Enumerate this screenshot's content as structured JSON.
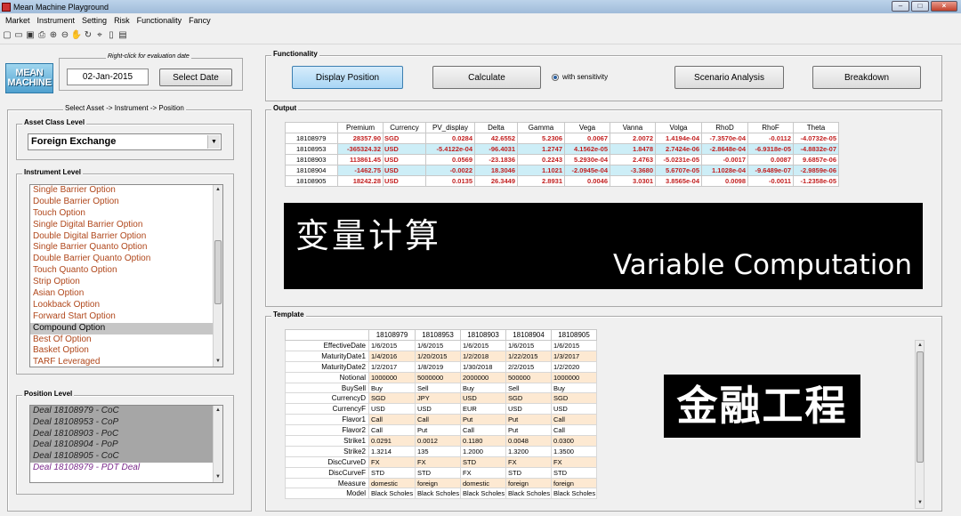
{
  "window": {
    "title": "Mean Machine Playground",
    "controls": [
      "–",
      "□",
      "×"
    ]
  },
  "menu": [
    "Market",
    "Instrument",
    "Setting",
    "Risk",
    "Functionality",
    "Fancy"
  ],
  "toolbar": {
    "icons": [
      "new-file-icon",
      "open-folder-icon",
      "save-icon",
      "print-icon",
      "zoom-in-icon",
      "zoom-out-icon",
      "pan-icon",
      "rotate-icon",
      "data-cursor-icon",
      "colorbar-icon",
      "legend-icon"
    ],
    "glyphs": [
      "▢",
      "▭",
      "▣",
      "⎙",
      "⊕",
      "⊖",
      "✋",
      "↻",
      "⌖",
      "▯",
      "▤"
    ]
  },
  "logo": {
    "line1": "MEAN",
    "line2": "MACHINE"
  },
  "date_group": {
    "hint": "Right-click for evaluation date",
    "date": "02-Jan-2015",
    "button": "Select Date"
  },
  "select_panel": {
    "title": "Select Asset -> Instrument -> Position",
    "asset_class_title": "Asset Class Level",
    "asset_class_value": "Foreign Exchange",
    "instrument_title": "Instrument Level",
    "instruments": [
      "Single Barrier Option",
      "Double Barrier Option",
      "Touch Option",
      "Single Digital Barrier Option",
      "Double Digital Barrier Option",
      "Single Barrier Quanto Option",
      "Double Barrier Quanto Option",
      "Touch Quanto Option",
      "Strip Option",
      "Asian Option",
      "Lookback Option",
      "Forward Start Option",
      "Compound Option",
      "Best Of Option",
      "Basket Option",
      "TARF Leveraged"
    ],
    "selected_instrument": "Compound Option",
    "position_title": "Position Level",
    "positions": [
      "Deal 18108979 - CoC",
      "Deal 18108953 - CoP",
      "Deal 18108903 - PoC",
      "Deal 18108904 - PoP",
      "Deal 18108905 - CoC",
      "Deal 18108979 - PDT Deal"
    ]
  },
  "functionality": {
    "title": "Functionality",
    "display_position": "Display Position",
    "calculate": "Calculate",
    "with_sensitivity": "with sensitivity",
    "scenario_analysis": "Scenario Analysis",
    "breakdown": "Breakdown"
  },
  "output": {
    "title": "Output",
    "columns": [
      "Premium",
      "Currency",
      "PV_display",
      "Delta",
      "Gamma",
      "Vega",
      "Vanna",
      "Volga",
      "RhoD",
      "RhoF",
      "Theta"
    ],
    "rows": [
      {
        "id": "18108979",
        "cells": [
          "28357.90",
          "SGD",
          "0.0284",
          "42.6552",
          "5.2306",
          "0.0067",
          "2.0072",
          "1.4194e-04",
          "-7.3570e-04",
          "-0.0112",
          "-4.0732e-05"
        ]
      },
      {
        "id": "18108953",
        "cells": [
          "-365324.32",
          "USD",
          "-5.4122e-04",
          "-96.4031",
          "1.2747",
          "4.1562e-05",
          "1.8478",
          "2.7424e-06",
          "-2.8648e-04",
          "-6.9318e-05",
          "-4.8832e-07"
        ]
      },
      {
        "id": "18108903",
        "cells": [
          "113861.45",
          "USD",
          "0.0569",
          "-23.1836",
          "0.2243",
          "5.2930e-04",
          "2.4763",
          "-5.0231e-05",
          "-0.0017",
          "0.0087",
          "9.6857e-06"
        ]
      },
      {
        "id": "18108904",
        "cells": [
          "-1462.75",
          "USD",
          "-0.0022",
          "18.3046",
          "1.1021",
          "-2.0945e-04",
          "-3.3680",
          "5.6707e-05",
          "1.1028e-04",
          "-9.6489e-07",
          "-2.9859e-06"
        ]
      },
      {
        "id": "18108905",
        "cells": [
          "18242.28",
          "USD",
          "0.0135",
          "26.3449",
          "2.8931",
          "0.0046",
          "3.0301",
          "3.8565e-04",
          "0.0098",
          "-0.0011",
          "-1.2358e-05"
        ]
      }
    ]
  },
  "overlay_top": {
    "chinese": "变量计算",
    "english": "Variable Computation"
  },
  "template": {
    "title": "Template",
    "deals": [
      "18108979",
      "18108953",
      "18108903",
      "18108904",
      "18108905"
    ],
    "rows": [
      {
        "label": "EffectiveDate",
        "values": [
          "1/6/2015",
          "1/6/2015",
          "1/6/2015",
          "1/6/2015",
          "1/6/2015"
        ]
      },
      {
        "label": "MaturityDate1",
        "values": [
          "1/4/2016",
          "1/20/2015",
          "1/2/2018",
          "1/22/2015",
          "1/3/2017"
        ]
      },
      {
        "label": "MaturityDate2",
        "values": [
          "1/2/2017",
          "1/8/2019",
          "1/30/2018",
          "2/2/2015",
          "1/2/2020"
        ]
      },
      {
        "label": "Notional",
        "values": [
          "1000000",
          "5000000",
          "2000000",
          "500000",
          "1000000"
        ]
      },
      {
        "label": "BuySell",
        "values": [
          "Buy",
          "Sell",
          "Buy",
          "Sell",
          "Buy"
        ]
      },
      {
        "label": "CurrencyD",
        "values": [
          "SGD",
          "JPY",
          "USD",
          "SGD",
          "SGD"
        ]
      },
      {
        "label": "CurrencyF",
        "values": [
          "USD",
          "USD",
          "EUR",
          "USD",
          "USD"
        ]
      },
      {
        "label": "Flavor1",
        "values": [
          "Call",
          "Call",
          "Put",
          "Put",
          "Call"
        ]
      },
      {
        "label": "Flavor2",
        "values": [
          "Call",
          "Put",
          "Call",
          "Put",
          "Call"
        ]
      },
      {
        "label": "Strike1",
        "values": [
          "0.0291",
          "0.0012",
          "0.1180",
          "0.0048",
          "0.0300"
        ]
      },
      {
        "label": "Strike2",
        "values": [
          "1.3214",
          "135",
          "1.2000",
          "1.3200",
          "1.3500"
        ]
      },
      {
        "label": "DiscCurveD",
        "values": [
          "FX",
          "FX",
          "STD",
          "FX",
          "FX"
        ]
      },
      {
        "label": "DiscCurveF",
        "values": [
          "STD",
          "STD",
          "FX",
          "STD",
          "STD"
        ]
      },
      {
        "label": "Measure",
        "values": [
          "domestic",
          "foreign",
          "domestic",
          "foreign",
          "foreign"
        ]
      },
      {
        "label": "Model",
        "values": [
          "Black Scholes",
          "Black Scholes",
          "Black Scholes",
          "Black Scholes",
          "Black Scholes"
        ]
      }
    ]
  },
  "overlay_bottom": {
    "chinese": "金融工程"
  },
  "colors": {
    "value_red": "#c21f1f",
    "row_highlight": "#cdeef7",
    "template_stripe": "#fde9d2",
    "instrument_text": "#b0471b",
    "selected_gray": "#c6c6c6"
  }
}
